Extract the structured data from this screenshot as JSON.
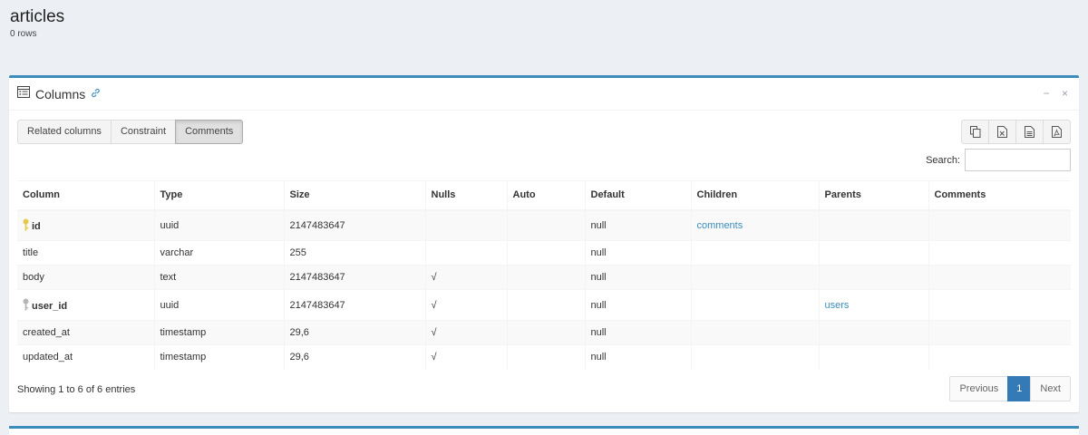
{
  "header": {
    "title": "articles",
    "subtitle": "0 rows"
  },
  "box": {
    "title": "Columns",
    "tools": {
      "minimize": "−",
      "close": "×"
    },
    "tabs": [
      {
        "label": "Related columns",
        "active": false
      },
      {
        "label": "Constraint",
        "active": false
      },
      {
        "label": "Comments",
        "active": true
      }
    ],
    "export_buttons": [
      "copy-icon",
      "excel-icon",
      "csv-icon",
      "pdf-icon"
    ],
    "search_label": "Search:",
    "search_value": ""
  },
  "table": {
    "headers": [
      "Column",
      "Type",
      "Size",
      "Nulls",
      "Auto",
      "Default",
      "Children",
      "Parents",
      "Comments"
    ],
    "rows": [
      {
        "column": "id",
        "key": "primary",
        "type": "uuid",
        "size": "2147483647",
        "nulls": "",
        "auto": "",
        "default": "null",
        "children": "comments",
        "parents": "",
        "comments": ""
      },
      {
        "column": "title",
        "key": "",
        "type": "varchar",
        "size": "255",
        "nulls": "",
        "auto": "",
        "default": "null",
        "children": "",
        "parents": "",
        "comments": ""
      },
      {
        "column": "body",
        "key": "",
        "type": "text",
        "size": "2147483647",
        "nulls": "√",
        "auto": "",
        "default": "null",
        "children": "",
        "parents": "",
        "comments": ""
      },
      {
        "column": "user_id",
        "key": "foreign",
        "type": "uuid",
        "size": "2147483647",
        "nulls": "√",
        "auto": "",
        "default": "null",
        "children": "",
        "parents": "users",
        "comments": ""
      },
      {
        "column": "created_at",
        "key": "",
        "type": "timestamp",
        "size": "29,6",
        "nulls": "√",
        "auto": "",
        "default": "null",
        "children": "",
        "parents": "",
        "comments": ""
      },
      {
        "column": "updated_at",
        "key": "",
        "type": "timestamp",
        "size": "29,6",
        "nulls": "√",
        "auto": "",
        "default": "null",
        "children": "",
        "parents": "",
        "comments": ""
      }
    ]
  },
  "footer": {
    "info": "Showing 1 to 6 of 6 entries",
    "pagination": {
      "previous": "Previous",
      "current": "1",
      "next": "Next"
    }
  },
  "colors": {
    "accent": "#3c8dbc",
    "primary_key": "#e6c84a",
    "foreign_key": "#b5b5b5",
    "page_active": "#337ab7"
  }
}
